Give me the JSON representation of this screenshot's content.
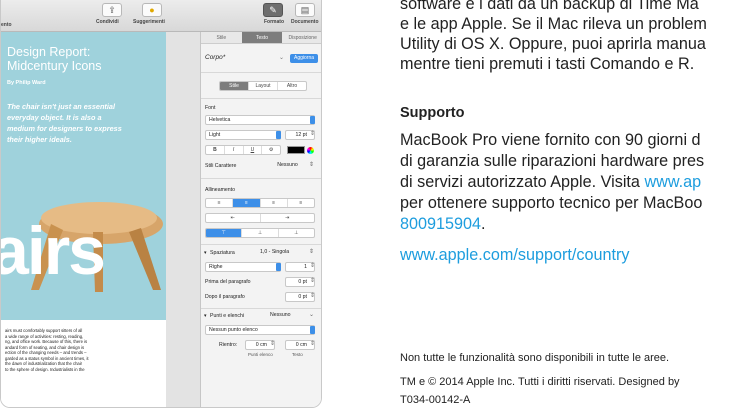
{
  "toolbar": {
    "cut_label": "ento",
    "share_label": "Condividi",
    "tips_label": "Suggerimenti",
    "format_label": "Formato",
    "document_label": "Documento"
  },
  "document": {
    "title_line1": "Design Report:",
    "title_line2": "Midcentury Icons",
    "author": "By Philip Ward",
    "quote": [
      "The chair isn't just an essential",
      "everyday object. It is also a",
      "medium for designers to express",
      "their higher ideals."
    ],
    "big_word": "airs",
    "body": [
      "airs must comfortably support sitters of all",
      "a wide range of activities: resting, reading,",
      "ng, and office work. Because of this, there is",
      "andard form of seating, and chair design is",
      "ection of the changing needs – and trends –",
      "garded as a status symbol in ancient times, it",
      "the dawn of industrialization that the chair",
      "to the sphere of design. Industrialists in the"
    ]
  },
  "inspector": {
    "tabs": [
      "Stile",
      "Testo",
      "Disposizione"
    ],
    "style_value": "Corpo*",
    "update_button": "Aggiorna",
    "sub_tabs": [
      "Stile",
      "Layout",
      "Altro"
    ],
    "font_label": "Font",
    "font_value": "Helvetica",
    "weight_value": "Light",
    "size_value": "12 pt",
    "bold": "B",
    "italic": "I",
    "underline": "U",
    "char_styles_label": "Stili Carattere",
    "char_styles_value": "Nessuno",
    "alignment_label": "Allineamento",
    "align_h": [
      "≡",
      "≡",
      "≡",
      "≡"
    ],
    "indent": [
      "⇤",
      "⇥"
    ],
    "align_v": [
      "⊤",
      "⊥",
      "⊥"
    ],
    "spacing_label": "Spaziatura",
    "spacing_value": "1,0 - Singola",
    "lines_label": "Righe",
    "lines_value": "1",
    "before_label": "Prima del paragrafo",
    "before_value": "0 pt",
    "after_label": "Dopo il paragrafo",
    "after_value": "0 pt",
    "bullets_label": "Punti e elenchi",
    "bullets_value": "Nessuno",
    "list_value": "Nessun punto elenco",
    "indent_label": "Rientro:",
    "bullet_indent": "0 cm",
    "text_indent": "0 cm",
    "bullet_indent_caption": "Punti elenco",
    "text_indent_caption": "Testo"
  },
  "right_text": {
    "lines_top": [
      "software e i dati da un backup di Time Ma",
      "e le app Apple. Se il Mac rileva un problem",
      "Utility di OS X. Oppure, puoi aprirla manua",
      "mentre tieni premuti i tasti Comando e R."
    ],
    "support_heading": "Supporto",
    "support_line1": "MacBook Pro viene fornito con 90 giorni d",
    "support_line2": "di garanzia sulle riparazioni hardware pres",
    "support_line3_pre": "di servizi autorizzato Apple. Visita ",
    "support_line3_link": "www.ap",
    "support_line4": "per ottenere supporto tecnico per MacBoo",
    "support_phone": "800915904",
    "support_phone_suffix": ".",
    "support_url": "www.apple.com/support/country",
    "note": "Non tutte le funzionalità sono disponibili in tutte le aree.",
    "footer1": "TM e © 2014 Apple Inc. Tutti i diritti riservati. Designed by",
    "footer2": "T034-00142-A"
  },
  "colors": {
    "link": "#1d9dde",
    "poster_bg": "#9fd2dc",
    "inspector_accent": "#3d8fe8"
  }
}
